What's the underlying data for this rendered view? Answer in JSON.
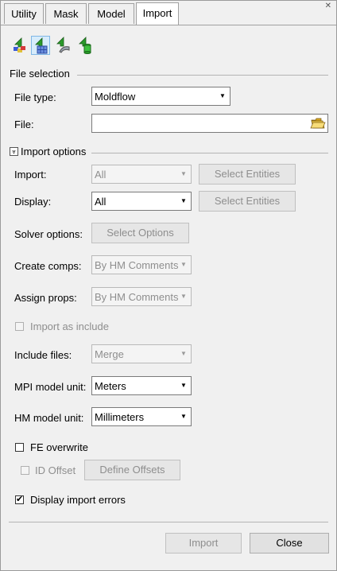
{
  "tabs": [
    {
      "label": "Utility"
    },
    {
      "label": "Mask"
    },
    {
      "label": "Model"
    },
    {
      "label": "Import"
    }
  ],
  "toolbar": {
    "icons": [
      "import-solver-deck-icon",
      "import-model-icon",
      "import-geometry-icon",
      "import-connectors-icon"
    ]
  },
  "file_selection": {
    "title": "File selection",
    "file_type_label": "File type:",
    "file_type_value": "Moldflow",
    "file_label": "File:",
    "file_value": ""
  },
  "import_options": {
    "title": "Import options",
    "import_label": "Import:",
    "import_value": "All",
    "import_select_button": "Select Entities",
    "display_label": "Display:",
    "display_value": "All",
    "display_select_button": "Select Entities",
    "solver_options_label": "Solver options:",
    "solver_options_button": "Select Options",
    "create_comps_label": "Create comps:",
    "create_comps_value": "By HM Comments",
    "assign_props_label": "Assign props:",
    "assign_props_value": "By HM Comments",
    "import_as_include_label": "Import as include",
    "include_files_label": "Include files:",
    "include_files_value": "Merge",
    "mpi_unit_label": "MPI model unit:",
    "mpi_unit_value": "Meters",
    "hm_unit_label": "HM model unit:",
    "hm_unit_value": "Millimeters",
    "fe_overwrite_label": "FE overwrite",
    "id_offset_label": "ID Offset",
    "define_offsets_button": "Define Offsets",
    "display_errors_label": "Display import errors",
    "display_errors_checked": true,
    "fe_overwrite_checked": false
  },
  "footer": {
    "import_button": "Import",
    "close_button": "Close"
  }
}
